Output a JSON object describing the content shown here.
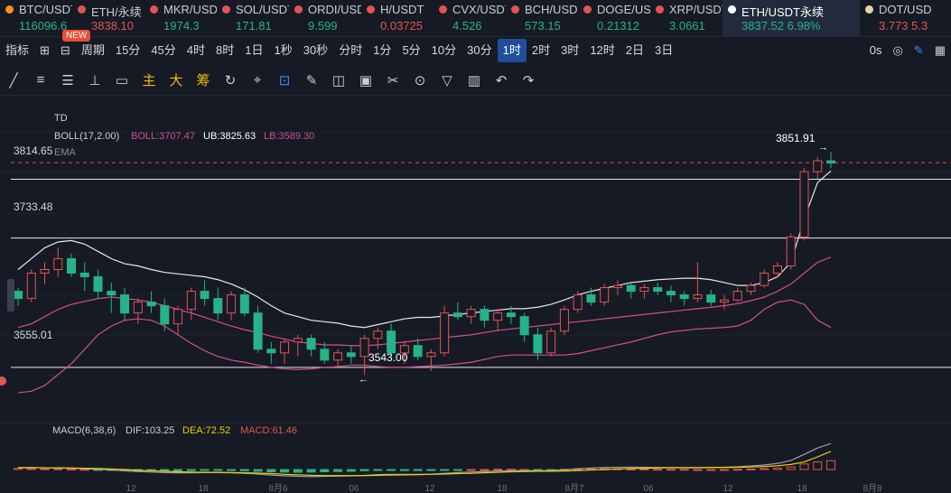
{
  "tickers": [
    {
      "name": "BTC/USDT",
      "price": "116096.6",
      "color": "#f7931a",
      "trend": "up"
    },
    {
      "name": "ETH/永续",
      "price": "3838.10",
      "color": "#e0564f",
      "trend": "dn"
    },
    {
      "name": "MKR/USDT",
      "price": "1974.3",
      "color": "#e0564f",
      "trend": "up"
    },
    {
      "name": "SOL/USDT",
      "price": "171.81",
      "color": "#e0564f",
      "trend": "up"
    },
    {
      "name": "ORDI/USDT",
      "price": "9.599",
      "color": "#e0564f",
      "trend": "up"
    },
    {
      "name": "H/USDT",
      "price": "0.03725",
      "color": "#e0564f",
      "trend": "dn"
    },
    {
      "name": "CVX/USDT",
      "price": "4.526",
      "color": "#e0564f",
      "trend": "up"
    },
    {
      "name": "BCH/USDT",
      "price": "573.15",
      "color": "#e0564f",
      "trend": "up"
    },
    {
      "name": "DOGE/USDT",
      "price": "0.21312",
      "color": "#e0564f",
      "trend": "up"
    },
    {
      "name": "XRP/USDT",
      "price": "3.0661",
      "color": "#e0564f",
      "trend": "up"
    },
    {
      "name": "ETH/USDT永续",
      "price": "3837.52  6.98%",
      "color": "#ffffff",
      "trend": "up",
      "active": true
    },
    {
      "name": "DOT/USDT",
      "price": "3.773  5.3",
      "color": "#e8d5a0",
      "trend": "dn"
    }
  ],
  "badge": "NEW",
  "toolbar_periods": [
    "指标",
    "⊞",
    "⊟",
    "周期",
    "15分",
    "45分",
    "4时",
    "8时",
    "1日",
    "1秒",
    "30秒",
    "分时",
    "1分",
    "5分",
    "10分",
    "30分",
    "1时",
    "2时",
    "3时",
    "12时",
    "2日",
    "3日"
  ],
  "active_period": "1时",
  "toolbar_right": {
    "zoom": "0s"
  },
  "draw_tools": [
    "╱",
    "≡",
    "☰",
    "⊥",
    "▭",
    "主",
    "大",
    "筹",
    "↻",
    "⌖",
    "⊡",
    "✎",
    "◫",
    "▣",
    "✂",
    "⊙",
    "▽",
    "▥",
    "↶",
    "↷"
  ],
  "indicators": {
    "td": "TD",
    "boll_name": "BOLL(17,2.00)",
    "boll_mid": "BOLL:3707.47",
    "boll_ub": "UB:3825.63",
    "boll_lb": "LB:3589.30",
    "ema": "EMA",
    "macd_name": "MACD(6,38,6)",
    "dif": "DIF:103.25",
    "dea": "DEA:72.52",
    "macd": "MACD:61.46"
  },
  "price_labels": {
    "h1": "3814.65",
    "h2": "3733.48",
    "h3": "3555.01",
    "high": "3851.91",
    "low": "3543.00"
  },
  "time_labels": [
    "12",
    "18",
    "8月6",
    "06",
    "12",
    "18",
    "8月7",
    "06",
    "12",
    "18",
    "8月8"
  ],
  "chart_data": {
    "type": "candlestick",
    "ylim": [
      3500,
      3880
    ],
    "candles": [
      [
        3660,
        3665,
        3640,
        3650
      ],
      [
        3650,
        3690,
        3645,
        3685
      ],
      [
        3685,
        3700,
        3670,
        3690
      ],
      [
        3690,
        3720,
        3680,
        3705
      ],
      [
        3705,
        3712,
        3680,
        3685
      ],
      [
        3685,
        3700,
        3660,
        3680
      ],
      [
        3680,
        3690,
        3650,
        3660
      ],
      [
        3660,
        3672,
        3630,
        3655
      ],
      [
        3655,
        3665,
        3620,
        3630
      ],
      [
        3630,
        3650,
        3615,
        3645
      ],
      [
        3645,
        3660,
        3630,
        3640
      ],
      [
        3640,
        3650,
        3605,
        3615
      ],
      [
        3615,
        3640,
        3600,
        3635
      ],
      [
        3635,
        3665,
        3620,
        3660
      ],
      [
        3660,
        3675,
        3640,
        3650
      ],
      [
        3650,
        3665,
        3620,
        3630
      ],
      [
        3630,
        3660,
        3620,
        3655
      ],
      [
        3655,
        3665,
        3625,
        3630
      ],
      [
        3630,
        3640,
        3575,
        3580
      ],
      [
        3580,
        3590,
        3560,
        3575
      ],
      [
        3575,
        3595,
        3560,
        3590
      ],
      [
        3590,
        3600,
        3570,
        3595
      ],
      [
        3595,
        3600,
        3570,
        3580
      ],
      [
        3580,
        3590,
        3560,
        3565
      ],
      [
        3565,
        3580,
        3555,
        3575
      ],
      [
        3575,
        3585,
        3560,
        3570
      ],
      [
        3570,
        3600,
        3545,
        3595
      ],
      [
        3595,
        3610,
        3580,
        3605
      ],
      [
        3605,
        3615,
        3570,
        3575
      ],
      [
        3575,
        3590,
        3560,
        3585
      ],
      [
        3585,
        3595,
        3565,
        3570
      ],
      [
        3570,
        3580,
        3550,
        3575
      ],
      [
        3575,
        3640,
        3570,
        3630
      ],
      [
        3630,
        3645,
        3620,
        3625
      ],
      [
        3625,
        3640,
        3615,
        3635
      ],
      [
        3635,
        3640,
        3610,
        3620
      ],
      [
        3620,
        3635,
        3605,
        3630
      ],
      [
        3630,
        3640,
        3615,
        3625
      ],
      [
        3625,
        3630,
        3590,
        3600
      ],
      [
        3600,
        3610,
        3565,
        3575
      ],
      [
        3575,
        3610,
        3570,
        3605
      ],
      [
        3605,
        3640,
        3600,
        3635
      ],
      [
        3635,
        3660,
        3630,
        3655
      ],
      [
        3655,
        3665,
        3640,
        3645
      ],
      [
        3645,
        3670,
        3640,
        3665
      ],
      [
        3665,
        3675,
        3655,
        3668
      ],
      [
        3668,
        3672,
        3650,
        3660
      ],
      [
        3660,
        3670,
        3650,
        3665
      ],
      [
        3665,
        3672,
        3655,
        3660
      ],
      [
        3660,
        3668,
        3645,
        3655
      ],
      [
        3655,
        3660,
        3640,
        3650
      ],
      [
        3650,
        3700,
        3645,
        3655
      ],
      [
        3655,
        3662,
        3640,
        3645
      ],
      [
        3645,
        3655,
        3635,
        3648
      ],
      [
        3648,
        3665,
        3645,
        3660
      ],
      [
        3660,
        3672,
        3655,
        3668
      ],
      [
        3668,
        3690,
        3665,
        3685
      ],
      [
        3685,
        3700,
        3680,
        3695
      ],
      [
        3695,
        3740,
        3690,
        3735
      ],
      [
        3735,
        3830,
        3730,
        3825
      ],
      [
        3825,
        3845,
        3815,
        3840
      ],
      [
        3840,
        3852,
        3830,
        3837
      ]
    ],
    "boll_upper": [
      3690,
      3705,
      3720,
      3728,
      3730,
      3725,
      3715,
      3705,
      3698,
      3695,
      3690,
      3686,
      3684,
      3682,
      3680,
      3676,
      3670,
      3662,
      3652,
      3640,
      3630,
      3625,
      3620,
      3618,
      3616,
      3612,
      3610,
      3614,
      3618,
      3622,
      3624,
      3624,
      3626,
      3628,
      3630,
      3632,
      3634,
      3636,
      3636,
      3638,
      3642,
      3648,
      3655,
      3660,
      3664,
      3668,
      3672,
      3674,
      3676,
      3677,
      3678,
      3678,
      3676,
      3672,
      3668,
      3668,
      3672,
      3680,
      3700,
      3760,
      3810,
      3826
    ],
    "boll_lower": [
      3520,
      3522,
      3530,
      3545,
      3560,
      3580,
      3600,
      3612,
      3620,
      3622,
      3620,
      3612,
      3600,
      3588,
      3578,
      3570,
      3565,
      3562,
      3558,
      3555,
      3553,
      3552,
      3553,
      3555,
      3556,
      3558,
      3558,
      3556,
      3555,
      3555,
      3556,
      3557,
      3558,
      3560,
      3562,
      3566,
      3570,
      3572,
      3572,
      3572,
      3572,
      3572,
      3574,
      3578,
      3582,
      3586,
      3590,
      3595,
      3600,
      3604,
      3606,
      3608,
      3609,
      3610,
      3612,
      3620,
      3635,
      3645,
      3648,
      3642,
      3620,
      3610
    ],
    "boll_mid": [
      3610,
      3615,
      3625,
      3635,
      3642,
      3646,
      3650,
      3652,
      3650,
      3648,
      3645,
      3640,
      3635,
      3630,
      3624,
      3618,
      3612,
      3607,
      3603,
      3598,
      3594,
      3590,
      3588,
      3586,
      3586,
      3585,
      3585,
      3586,
      3588,
      3590,
      3592,
      3594,
      3596,
      3598,
      3600,
      3603,
      3606,
      3608,
      3610,
      3612,
      3614,
      3616,
      3618,
      3620,
      3622,
      3624,
      3626,
      3628,
      3630,
      3632,
      3634,
      3636,
      3638,
      3640,
      3643,
      3647,
      3652,
      3660,
      3670,
      3685,
      3700,
      3707
    ],
    "macd_hist": [
      5,
      4,
      3,
      3,
      2,
      1,
      -1,
      -2,
      -3,
      -4,
      -4,
      -5,
      -5,
      -4,
      -3,
      -3,
      -4,
      -5,
      -7,
      -9,
      -10,
      -11,
      -10,
      -9,
      -8,
      -7,
      -5,
      -3,
      -3,
      -4,
      -4,
      -4,
      -2,
      -1,
      0,
      0,
      1,
      1,
      0,
      -1,
      -1,
      1,
      2,
      3,
      3,
      3,
      2,
      2,
      1,
      1,
      1,
      0,
      0,
      0,
      1,
      2,
      4,
      6,
      10,
      22,
      30,
      35
    ],
    "dif": [
      8,
      8,
      7,
      6,
      5,
      3,
      1,
      -2,
      -5,
      -8,
      -10,
      -12,
      -13,
      -13,
      -12,
      -12,
      -13,
      -15,
      -18,
      -22,
      -25,
      -27,
      -28,
      -27,
      -26,
      -25,
      -23,
      -20,
      -19,
      -19,
      -19,
      -18,
      -15,
      -12,
      -10,
      -8,
      -6,
      -4,
      -4,
      -5,
      -4,
      -1,
      3,
      6,
      8,
      9,
      9,
      9,
      8,
      8,
      8,
      8,
      8,
      9,
      11,
      14,
      18,
      24,
      36,
      60,
      85,
      103
    ],
    "dea": [
      6,
      7,
      7,
      7,
      6,
      5,
      4,
      2,
      0,
      -3,
      -5,
      -7,
      -9,
      -10,
      -11,
      -11,
      -12,
      -13,
      -14,
      -16,
      -19,
      -21,
      -23,
      -24,
      -24,
      -24,
      -24,
      -23,
      -22,
      -21,
      -20,
      -19,
      -18,
      -16,
      -15,
      -13,
      -11,
      -9,
      -8,
      -7,
      -7,
      -6,
      -4,
      -2,
      0,
      2,
      4,
      5,
      6,
      7,
      7,
      7,
      8,
      8,
      9,
      10,
      12,
      15,
      20,
      30,
      50,
      72
    ]
  }
}
